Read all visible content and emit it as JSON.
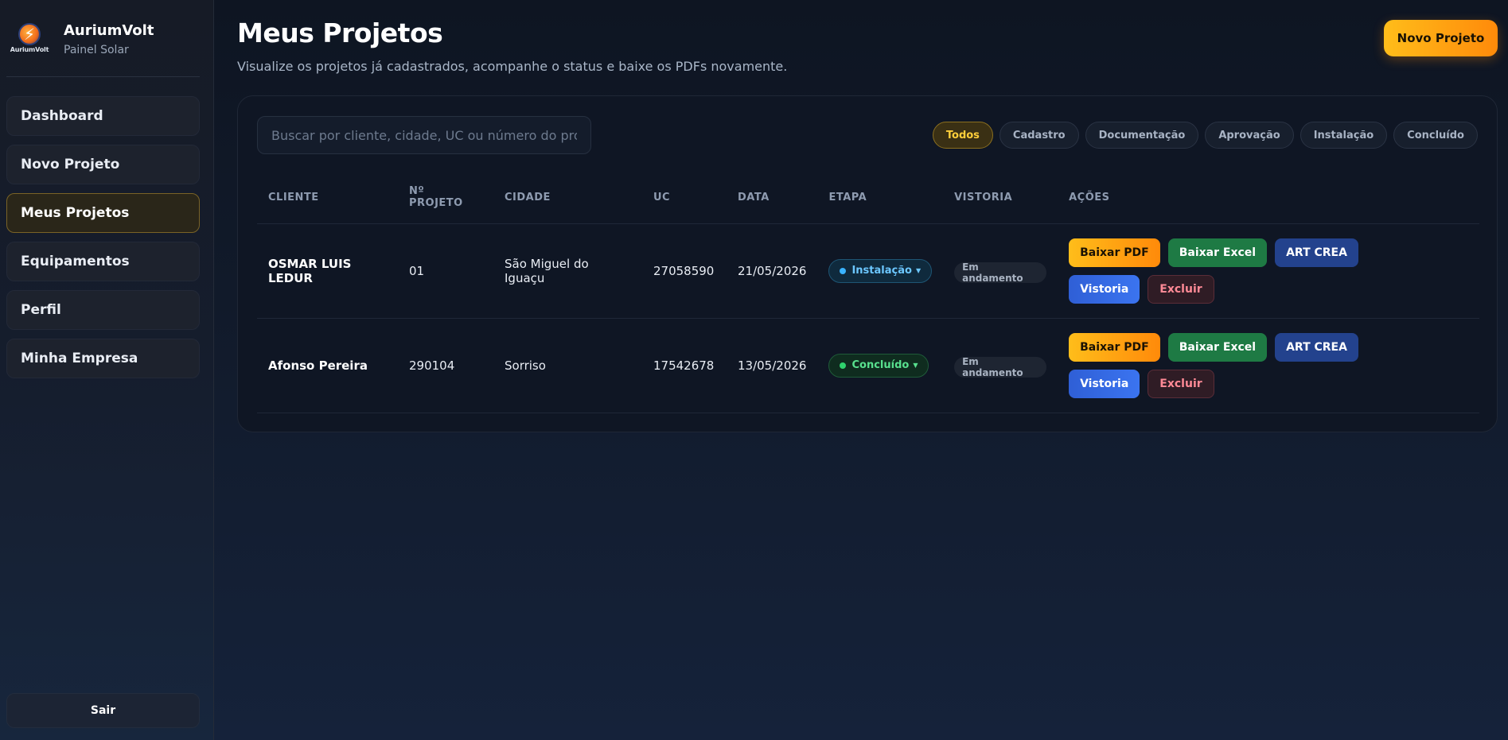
{
  "brand": {
    "logo_text": "AuriumVolt",
    "title": "AuriumVolt",
    "subtitle": "Painel Solar"
  },
  "sidebar": {
    "items": [
      {
        "label": "Dashboard",
        "active": false
      },
      {
        "label": "Novo Projeto",
        "active": false
      },
      {
        "label": "Meus Projetos",
        "active": true
      },
      {
        "label": "Equipamentos",
        "active": false
      },
      {
        "label": "Perfil",
        "active": false
      },
      {
        "label": "Minha Empresa",
        "active": false
      }
    ],
    "logout": "Sair"
  },
  "header": {
    "title": "Meus Projetos",
    "subtitle": "Visualize os projetos já cadastrados, acompanhe o status e baixe os PDFs novamente.",
    "new_button": "Novo Projeto"
  },
  "search": {
    "placeholder": "Buscar por cliente, cidade, UC ou número do projeto",
    "value": ""
  },
  "filters": [
    "Todos",
    "Cadastro",
    "Documentação",
    "Aprovação",
    "Instalação",
    "Concluído"
  ],
  "active_filter": "Todos",
  "table": {
    "headers": {
      "cliente": "CLIENTE",
      "numero": "Nº PROJETO",
      "cidade": "CIDADE",
      "uc": "UC",
      "data": "DATA",
      "etapa": "ETAPA",
      "vistoria": "VISTORIA",
      "acoes": "AÇÕES"
    },
    "rows": [
      {
        "cliente": "OSMAR LUIS LEDUR",
        "numero": "01",
        "cidade": "São Miguel do Iguaçu",
        "uc": "27058590",
        "data": "21/05/2026",
        "etapa": "Instalação",
        "vistoria": "Em andamento"
      },
      {
        "cliente": "Afonso Pereira",
        "numero": "290104",
        "cidade": "Sorriso",
        "uc": "17542678",
        "data": "13/05/2026",
        "etapa": "Concluído",
        "vistoria": "Em andamento"
      }
    ],
    "actions": {
      "pdf": "Baixar PDF",
      "excel": "Baixar Excel",
      "art": "ART CREA",
      "vistoria": "Vistoria",
      "excluir": "Excluir"
    }
  },
  "colors": {
    "accent": "#ff9f10",
    "install": "#3ab3ff",
    "done": "#2fd26d",
    "excel": "#1e7a44",
    "art": "#23428d",
    "vistoria": "#3b74f0"
  },
  "icons": {
    "logo": "lightning-bolt-icon",
    "etapa_dot": "status-dot-icon",
    "etapa_caret": "caret-down-icon"
  }
}
